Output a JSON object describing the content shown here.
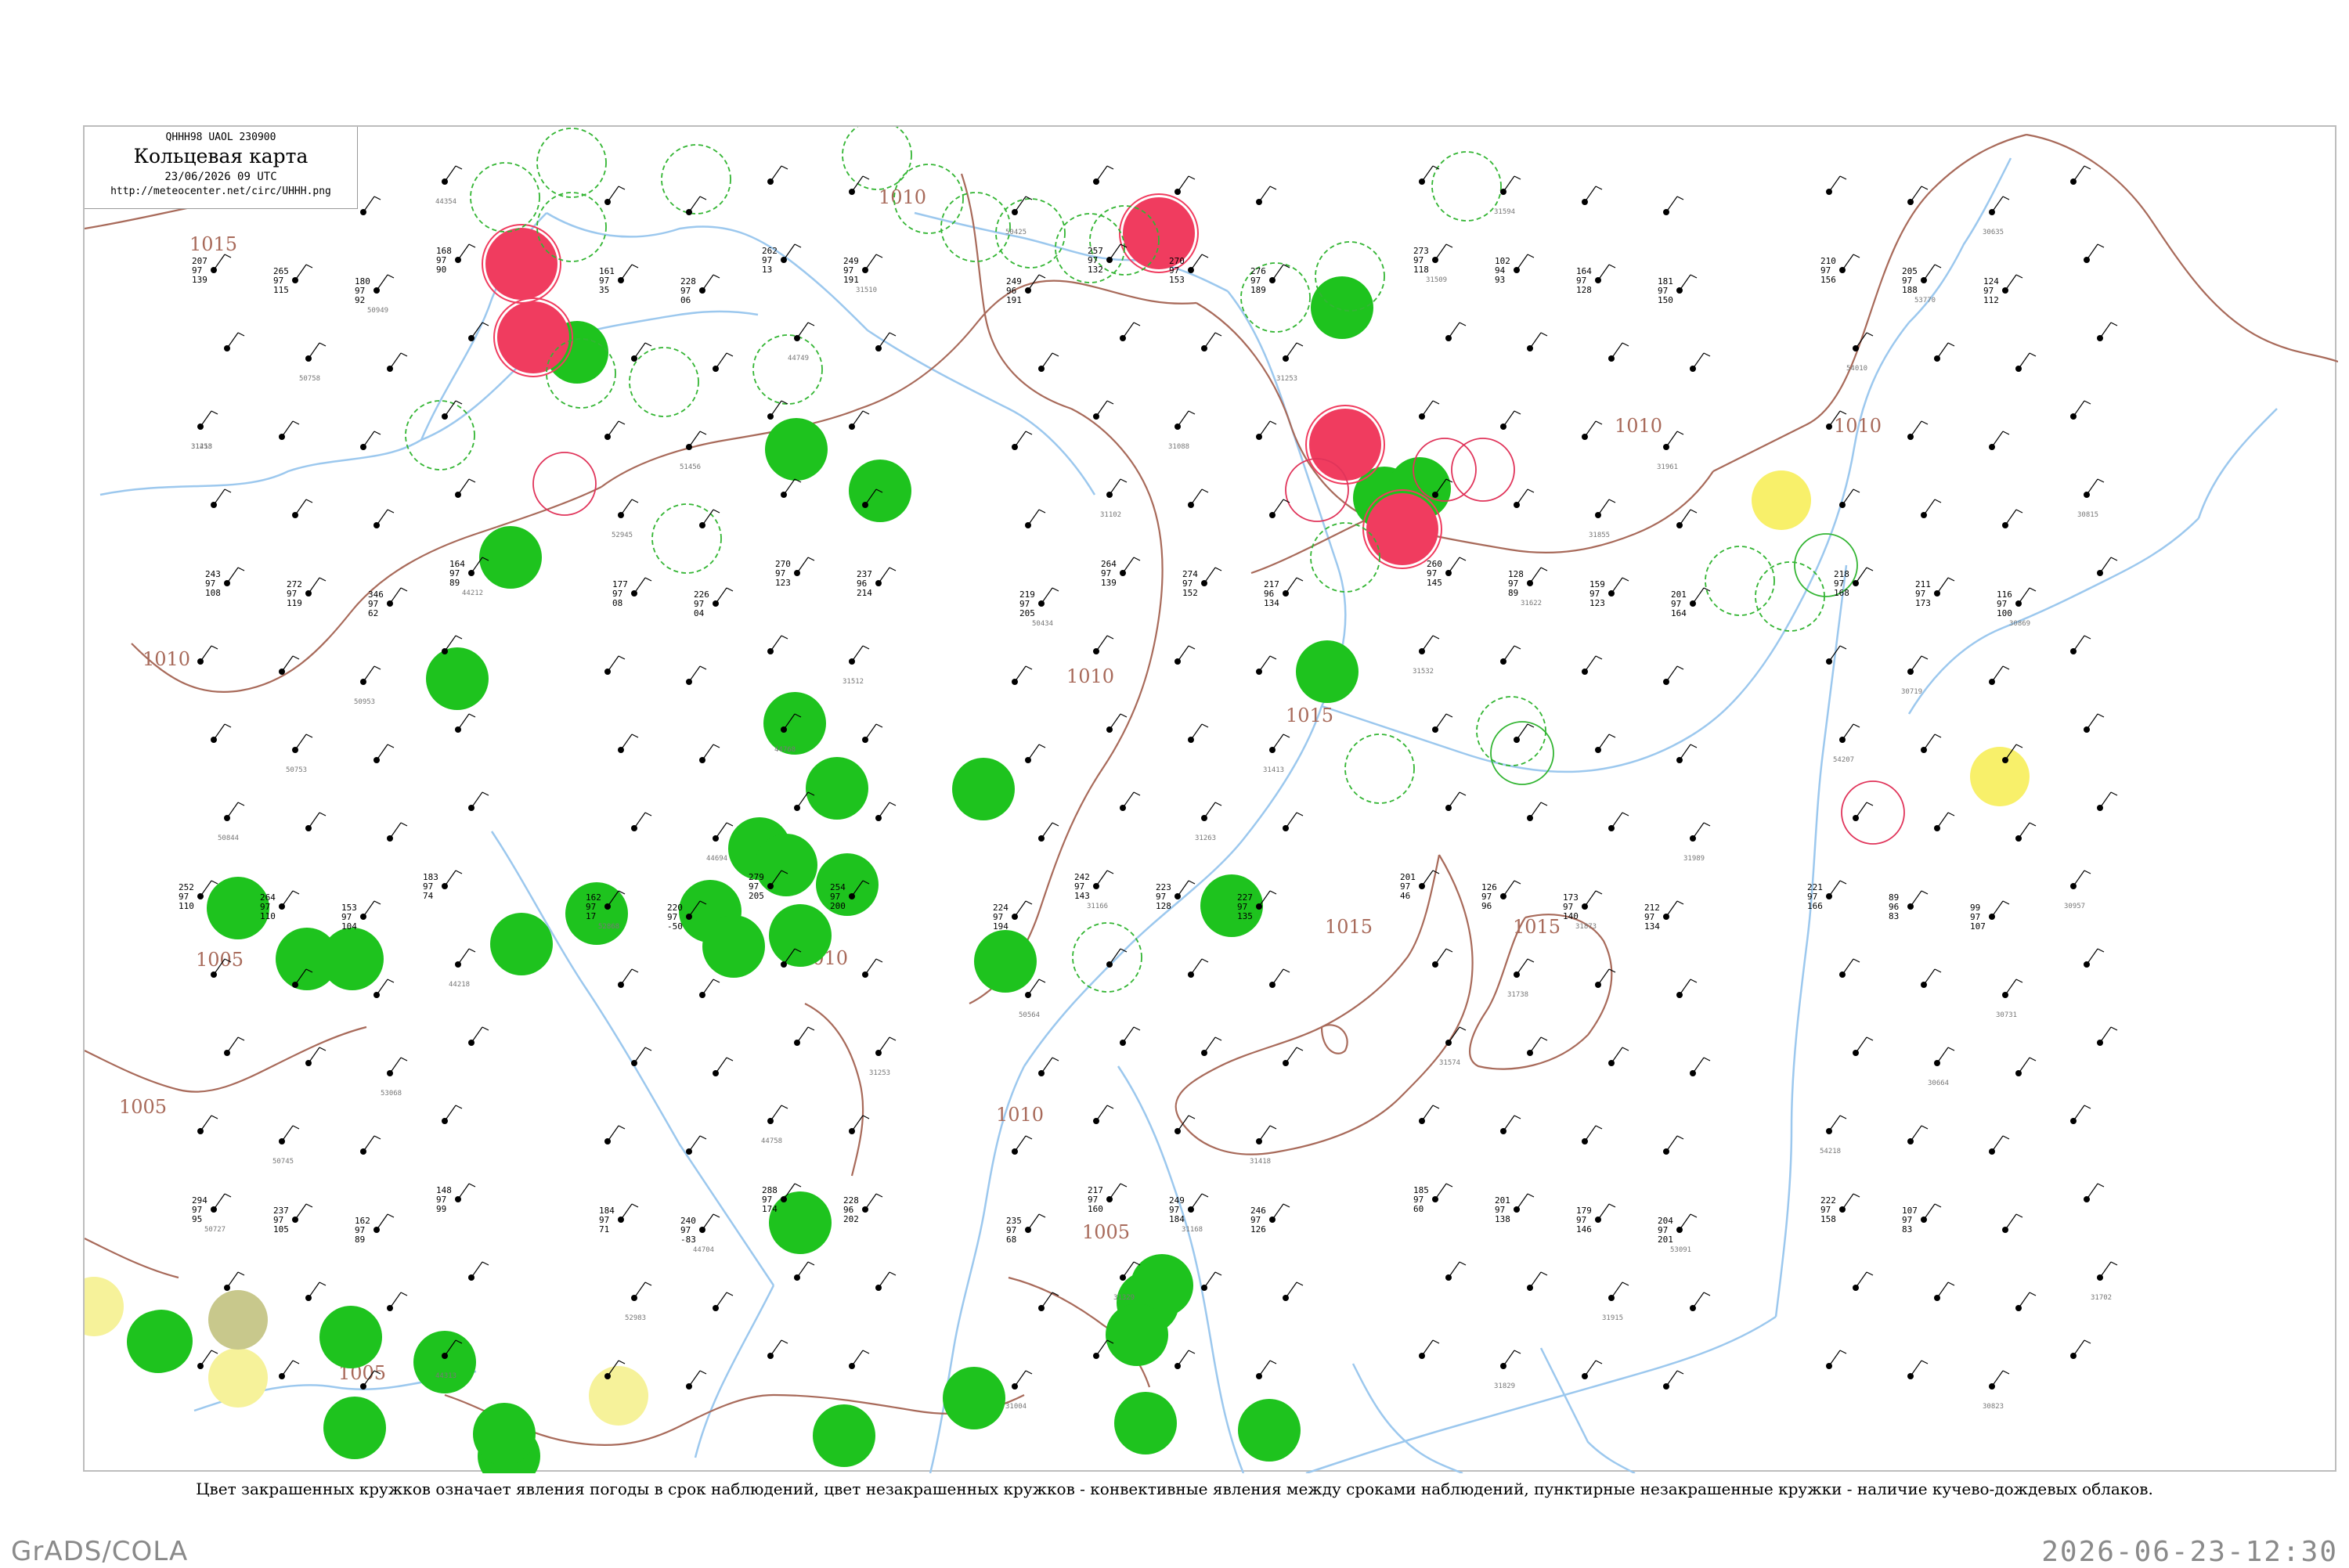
{
  "title_box": {
    "code_line": "QHHH98  UAOL  230900",
    "title": "Кольцевая карта",
    "date": "23/06/2026 09 UTC",
    "url": "http://meteocenter.net/circ/UHHH.png"
  },
  "legend_text": "Цвет закрашенных кружков означает явления погоды в срок наблюдений, цвет незакрашенных кружков - конвективные явления между сроками наблюдений, пунктирные незакрашенные кружки - наличие кучево-дождевых облаков.",
  "footer": {
    "left": "GrADS/COLA",
    "right": "2026-06-23-12:30"
  },
  "colors": {
    "isobar": "#a86a5a",
    "river": "#9cc8ee",
    "rain_fill": "#1ec31e",
    "thunder_fill": "#f03c5f",
    "yellow_fill": "#f8f06a",
    "pale_yellow_fill": "#f6f29a",
    "olive_fill": "#c8c88c",
    "dashed_ring": "#33b533",
    "red_ring": "#e0345a",
    "frame": "#bdbdbd"
  },
  "isobar_labels": [
    "1010",
    "1015",
    "1010",
    "1015",
    "1010",
    "1015",
    "1015",
    "1010",
    "1010",
    "1005",
    "1005",
    "1005",
    "1010",
    "1005",
    "1010",
    "1010"
  ],
  "map_content": {
    "filled_circles": [
      {
        "kind": "rain"
      },
      {
        "kind": "rain"
      },
      {
        "kind": "rain"
      },
      {
        "kind": "rain"
      },
      {
        "kind": "rain"
      },
      {
        "kind": "rain"
      },
      {
        "kind": "rain"
      },
      {
        "kind": "rain"
      },
      {
        "kind": "rain"
      },
      {
        "kind": "rain"
      },
      {
        "kind": "rain"
      },
      {
        "kind": "rain"
      },
      {
        "kind": "rain"
      },
      {
        "kind": "rain"
      },
      {
        "kind": "rain"
      },
      {
        "kind": "rain"
      },
      {
        "kind": "rain"
      },
      {
        "kind": "rain"
      },
      {
        "kind": "rain"
      },
      {
        "kind": "rain"
      },
      {
        "kind": "rain"
      },
      {
        "kind": "rain"
      },
      {
        "kind": "rain"
      },
      {
        "kind": "rain"
      },
      {
        "kind": "rain"
      },
      {
        "kind": "rain"
      },
      {
        "kind": "rain"
      },
      {
        "kind": "rain"
      },
      {
        "kind": "rain"
      },
      {
        "kind": "rain"
      },
      {
        "kind": "rain"
      },
      {
        "kind": "rain"
      },
      {
        "kind": "rain"
      },
      {
        "kind": "rain"
      },
      {
        "kind": "rain"
      },
      {
        "kind": "rain"
      },
      {
        "kind": "rain"
      },
      {
        "kind": "rain"
      },
      {
        "kind": "rain"
      },
      {
        "kind": "rain"
      },
      {
        "kind": "thunder"
      },
      {
        "kind": "thunder"
      },
      {
        "kind": "thunder"
      },
      {
        "kind": "thunder"
      },
      {
        "kind": "thunder"
      },
      {
        "kind": "yellow"
      },
      {
        "kind": "yellow"
      },
      {
        "kind": "pale-yellow"
      },
      {
        "kind": "pale-yellow"
      },
      {
        "kind": "pale-yellow"
      },
      {
        "kind": "olive"
      }
    ],
    "station_labels": [
      {
        "a": "207",
        "b": "97",
        "c": "139"
      },
      {
        "a": "243",
        "b": "97",
        "c": "108"
      },
      {
        "a": "252",
        "b": "97",
        "c": "110"
      },
      {
        "a": "294",
        "b": "97",
        "c": "95"
      },
      {
        "a": "265",
        "b": "97",
        "c": "115"
      },
      {
        "a": "272",
        "b": "97",
        "c": "119"
      },
      {
        "a": "264",
        "b": "97",
        "c": "110"
      },
      {
        "a": "237",
        "b": "97",
        "c": "105"
      },
      {
        "a": "180",
        "b": "97",
        "c": "92"
      },
      {
        "a": "346",
        "b": "97",
        "c": "62"
      },
      {
        "a": "153",
        "b": "97",
        "c": "104"
      },
      {
        "a": "162",
        "b": "97",
        "c": "89"
      },
      {
        "a": "168",
        "b": "97",
        "c": "90"
      },
      {
        "a": "164",
        "b": "97",
        "c": "89"
      },
      {
        "a": "183",
        "b": "97",
        "c": "74"
      },
      {
        "a": "148",
        "b": "97",
        "c": "99"
      },
      {
        "a": "161",
        "b": "97",
        "c": "35"
      },
      {
        "a": "177",
        "b": "97",
        "c": "08"
      },
      {
        "a": "162",
        "b": "97",
        "c": "17"
      },
      {
        "a": "184",
        "b": "97",
        "c": "71"
      },
      {
        "a": "228",
        "b": "97",
        "c": "06"
      },
      {
        "a": "226",
        "b": "97",
        "c": "04"
      },
      {
        "a": "220",
        "b": "97",
        "c": "-50"
      },
      {
        "a": "240",
        "b": "97",
        "c": "-83"
      },
      {
        "a": "262",
        "b": "97",
        "c": "13"
      },
      {
        "a": "270",
        "b": "97",
        "c": "123"
      },
      {
        "a": "279",
        "b": "97",
        "c": "205"
      },
      {
        "a": "288",
        "b": "97",
        "c": "174"
      },
      {
        "a": "249",
        "b": "97",
        "c": "191"
      },
      {
        "a": "237",
        "b": "96",
        "c": "214"
      },
      {
        "a": "254",
        "b": "97",
        "c": "200"
      },
      {
        "a": "228",
        "b": "96",
        "c": "202"
      },
      {
        "a": "249",
        "b": "96",
        "c": "191"
      },
      {
        "a": "219",
        "b": "97",
        "c": "205"
      },
      {
        "a": "224",
        "b": "97",
        "c": "194"
      },
      {
        "a": "235",
        "b": "97",
        "c": "68"
      },
      {
        "a": "257",
        "b": "97",
        "c": "132"
      },
      {
        "a": "264",
        "b": "97",
        "c": "139"
      },
      {
        "a": "242",
        "b": "97",
        "c": "143"
      },
      {
        "a": "217",
        "b": "97",
        "c": "160"
      },
      {
        "a": "270",
        "b": "97",
        "c": "153"
      },
      {
        "a": "274",
        "b": "97",
        "c": "152"
      },
      {
        "a": "223",
        "b": "97",
        "c": "128"
      },
      {
        "a": "249",
        "b": "97",
        "c": "184"
      },
      {
        "a": "276",
        "b": "97",
        "c": "189"
      },
      {
        "a": "217",
        "b": "96",
        "c": "134"
      },
      {
        "a": "227",
        "b": "97",
        "c": "135"
      },
      {
        "a": "246",
        "b": "97",
        "c": "126"
      },
      {
        "a": "273",
        "b": "97",
        "c": "118"
      },
      {
        "a": "260",
        "b": "97",
        "c": "145"
      },
      {
        "a": "201",
        "b": "97",
        "c": "46"
      },
      {
        "a": "185",
        "b": "97",
        "c": "60"
      },
      {
        "a": "102",
        "b": "94",
        "c": "93"
      },
      {
        "a": "128",
        "b": "97",
        "c": "89"
      },
      {
        "a": "126",
        "b": "97",
        "c": "96"
      },
      {
        "a": "201",
        "b": "97",
        "c": "138"
      },
      {
        "a": "164",
        "b": "97",
        "c": "128"
      },
      {
        "a": "159",
        "b": "97",
        "c": "123"
      },
      {
        "a": "173",
        "b": "97",
        "c": "140"
      },
      {
        "a": "179",
        "b": "97",
        "c": "146"
      },
      {
        "a": "181",
        "b": "97",
        "c": "150"
      },
      {
        "a": "201",
        "b": "97",
        "c": "164"
      },
      {
        "a": "212",
        "b": "97",
        "c": "134"
      },
      {
        "a": "204",
        "b": "97",
        "c": "201"
      },
      {
        "a": "210",
        "b": "97",
        "c": "156"
      },
      {
        "a": "218",
        "b": "97",
        "c": "168"
      },
      {
        "a": "221",
        "b": "97",
        "c": "166"
      },
      {
        "a": "222",
        "b": "97",
        "c": "158"
      },
      {
        "a": "205",
        "b": "97",
        "c": "188"
      },
      {
        "a": "211",
        "b": "97",
        "c": "173"
      },
      {
        "a": "89",
        "b": "96",
        "c": "83"
      },
      {
        "a": "107",
        "b": "97",
        "c": "83"
      },
      {
        "a": "124",
        "b": "97",
        "c": "112"
      },
      {
        "a": "116",
        "b": "97",
        "c": "100"
      },
      {
        "a": "99",
        "b": "97",
        "c": "107"
      }
    ],
    "station_ids": [
      "31253",
      "50844",
      "50727",
      "50758",
      "50753",
      "50745",
      "50949",
      "50953",
      "53068",
      "44354",
      "44212",
      "44218",
      "44313",
      "52945",
      "52868",
      "52983",
      "51456",
      "44694",
      "44704",
      "44749",
      "44768",
      "44758",
      "31510",
      "31512",
      "31253",
      "50425",
      "50434",
      "50564",
      "31004",
      "31102",
      "31166",
      "31329",
      "31088",
      "31263",
      "31168",
      "31253",
      "31413",
      "31418",
      "31509",
      "31532",
      "31574",
      "31594",
      "31622",
      "31738",
      "31829",
      "31855",
      "31873",
      "31915",
      "31961",
      "31989",
      "53091",
      "54010",
      "54207",
      "54218",
      "53770",
      "30719",
      "30664",
      "30635",
      "30869",
      "30731",
      "30823",
      "30815",
      "30957",
      "31702",
      "31418"
    ]
  }
}
